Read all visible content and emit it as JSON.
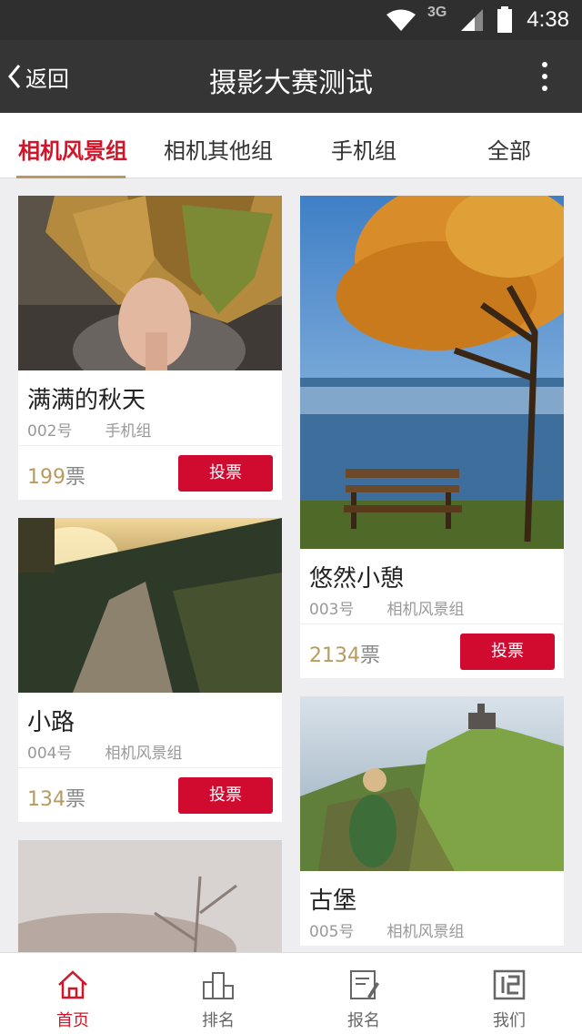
{
  "status_bar": {
    "network": "3G",
    "time": "4:38",
    "icons": [
      "wifi-icon",
      "cell-signal-icon",
      "battery-icon"
    ]
  },
  "header": {
    "back_label": "返回",
    "title": "摄影大赛测试",
    "more_icon": "more-vertical-icon"
  },
  "tabs": [
    {
      "label": "相机风景组",
      "active": true
    },
    {
      "label": "相机其他组",
      "active": false
    },
    {
      "label": "手机组",
      "active": false
    },
    {
      "label": "全部",
      "active": false
    }
  ],
  "cards": {
    "left": [
      {
        "title": "满满的秋天",
        "number": "002号",
        "group": "手机组",
        "votes": "199",
        "vote_unit": "票",
        "vote_label": "投票"
      },
      {
        "title": "小路",
        "number": "004号",
        "group": "相机风景组",
        "votes": "134",
        "vote_unit": "票",
        "vote_label": "投票"
      }
    ],
    "right": [
      {
        "title": "悠然小憩",
        "number": "003号",
        "group": "相机风景组",
        "votes": "2134",
        "vote_unit": "票",
        "vote_label": "投票"
      },
      {
        "title": "古堡",
        "number": "005号",
        "group": "相机风景组"
      }
    ]
  },
  "bottom_nav": [
    {
      "label": "首页",
      "icon": "home-icon",
      "active": true
    },
    {
      "label": "排名",
      "icon": "podium-icon",
      "active": false
    },
    {
      "label": "报名",
      "icon": "signup-icon",
      "active": false
    },
    {
      "label": "我们",
      "icon": "about-icon",
      "active": false
    }
  ],
  "colors": {
    "accent_red": "#d10a30",
    "gold": "#b89a60",
    "header_bg": "#353535"
  }
}
